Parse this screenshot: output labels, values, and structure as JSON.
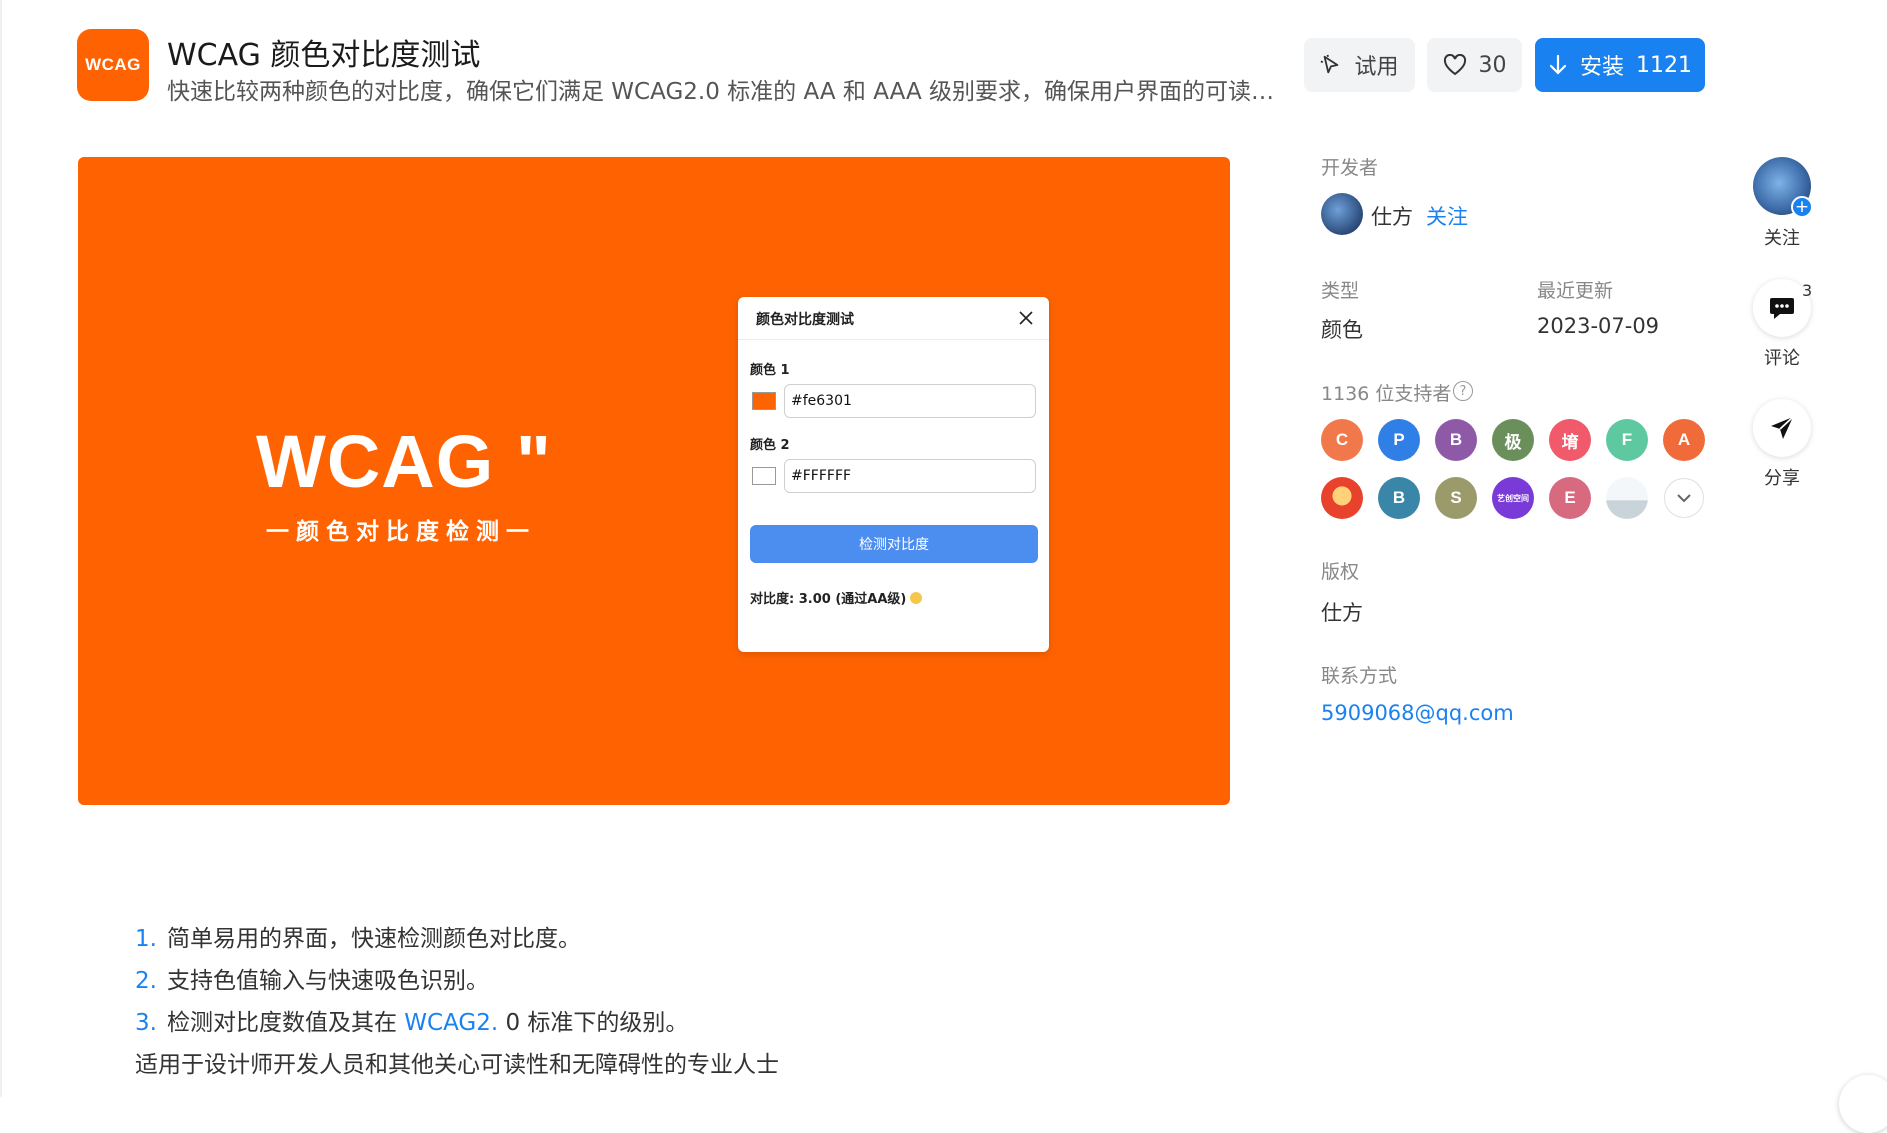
{
  "header": {
    "logo_text": "WCAG",
    "title": "WCAG 颜色对比度测试",
    "description": "快速比较两种颜色的对比度，确保它们满足 WCAG2.0 标准的 AA 和 AAA 级别要求，确保用户界面的可读性。",
    "try_label": "试用",
    "like_count": "30",
    "install_label": "安装",
    "install_count": "1121"
  },
  "hero": {
    "big_text": "WCAG \"",
    "sub_text": "一颜色对比度检测一",
    "dialog": {
      "title": "颜色对比度测试",
      "color1_label": "颜色 1",
      "color1_value": "#fe6301",
      "color1_swatch": "#fe6301",
      "color2_label": "颜色 2",
      "color2_value": "#FFFFFF",
      "color2_swatch": "#ffffff",
      "button_label": "检测对比度",
      "result": "对比度: 3.00 (通过AA级)"
    }
  },
  "info": {
    "developer_label": "开发者",
    "developer_name": "仕方",
    "follow_label": "关注",
    "type_label": "类型",
    "type_value": "颜色",
    "updated_label": "最近更新",
    "updated_value": "2023-07-09",
    "supporters_label": "1136 位支持者",
    "help_glyph": "?",
    "supporters": [
      {
        "letter": "C",
        "color": "#f0784a"
      },
      {
        "letter": "P",
        "color": "#2f7fe6"
      },
      {
        "letter": "B",
        "color": "#8e5aa8"
      },
      {
        "letter": "极",
        "color": "#6b8f5a"
      },
      {
        "letter": "堉",
        "color": "#f05a6a"
      },
      {
        "letter": "F",
        "color": "#5ec9a0"
      },
      {
        "letter": "A",
        "color": "#f06a3a"
      },
      {
        "letter": "",
        "color": "#e8412c"
      },
      {
        "letter": "B",
        "color": "#3a86a8"
      },
      {
        "letter": "S",
        "color": "#9a9a6a"
      },
      {
        "letter": "艺创空间",
        "color": "#7a3ad8"
      },
      {
        "letter": "E",
        "color": "#d86a80"
      },
      {
        "letter": "",
        "color": "#dfe6ea"
      }
    ],
    "copyright_label": "版权",
    "copyright_value": "仕方",
    "contact_label": "联系方式",
    "contact_value": "5909068@qq.com"
  },
  "rail": {
    "follow_label": "关注",
    "comment_label": "评论",
    "comment_count": "3",
    "share_label": "分享",
    "plus_glyph": "+"
  },
  "features": [
    {
      "num": "1.",
      "text": "简单易用的界面，快速检测颜色对比度。"
    },
    {
      "num": "2.",
      "text": "支持色值输入与快速吸色识别。"
    },
    {
      "num": "3.",
      "text_before": "检测对比度数值及其在 ",
      "link": "WCAG2.",
      "text_after": " 0 标准下的级别。"
    }
  ],
  "audience": "适用于设计师开发人员和其他关心可读性和无障碍性的专业人士"
}
